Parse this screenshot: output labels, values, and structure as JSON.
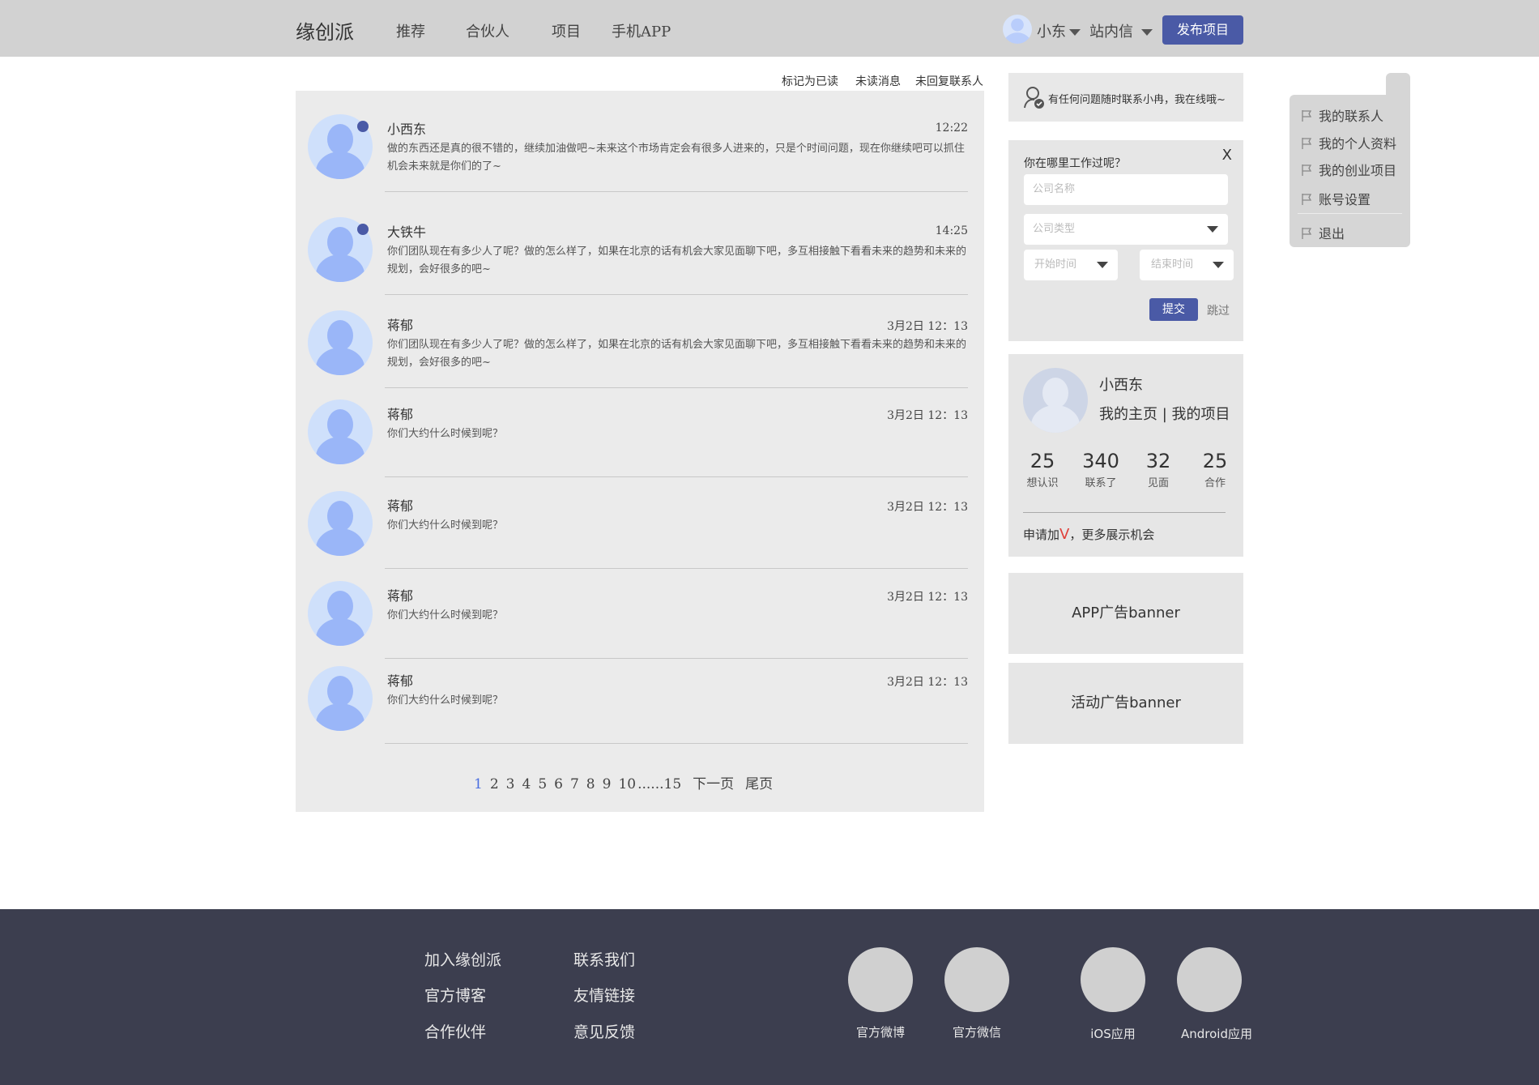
{
  "nav": {
    "logo": "缘创派",
    "items": [
      "推荐",
      "合伙人",
      "项目",
      "手机APP"
    ],
    "user": "小东",
    "messages": "站内信",
    "publish": "发布项目"
  },
  "actions": [
    "标记为已读",
    "未读消息",
    "未回复联系人"
  ],
  "messages": [
    {
      "name": "小西东",
      "time": "12:22",
      "unread": true,
      "text": "做的东西还是真的很不错的，继续加油做吧~未来这个市场肯定会有很多人进来的，只是个时间问题，现在你继续吧可以抓住机会未来就是你们的了~"
    },
    {
      "name": "大铁牛",
      "time": "14:25",
      "unread": true,
      "text": "你们团队现在有多少人了呢？做的怎么样了，如果在北京的话有机会大家见面聊下吧，多互相接触下看看未来的趋势和未来的规划，会好很多的吧~"
    },
    {
      "name": "蒋郁",
      "time": "3月2日 12：13",
      "unread": false,
      "text": "你们团队现在有多少人了呢？做的怎么样了，如果在北京的话有机会大家见面聊下吧，多互相接触下看看未来的趋势和未来的规划，会好很多的吧~"
    },
    {
      "name": "蒋郁",
      "time": "3月2日 12：13",
      "unread": false,
      "text": "你们大约什么时候到呢？"
    },
    {
      "name": "蒋郁",
      "time": "3月2日 12：13",
      "unread": false,
      "text": "你们大约什么时候到呢？"
    },
    {
      "name": "蒋郁",
      "time": "3月2日 12：13",
      "unread": false,
      "text": "你们大约什么时候到呢？"
    },
    {
      "name": "蒋郁",
      "time": "3月2日 12：13",
      "unread": false,
      "text": "你们大约什么时候到呢？"
    }
  ],
  "pagination": [
    "1",
    "2",
    "3",
    "4",
    "5",
    "6",
    "7",
    "8",
    "9",
    "10",
    "......15",
    "下一页",
    "尾页"
  ],
  "help": "有任何问题随时联系小冉，我在线哦~",
  "work_form": {
    "question": "你在哪里工作过呢？",
    "close": "X",
    "company_name_placeholder": "公司名称",
    "company_type_placeholder": "公司类型",
    "start_placeholder": "开始时间",
    "end_placeholder": "结束时间",
    "submit": "提交",
    "skip": "跳过"
  },
  "profile": {
    "name": "小西东",
    "links": "我的主页 | 我的项目",
    "stats": [
      {
        "num": "25",
        "label": "想认识"
      },
      {
        "num": "340",
        "label": "联系了"
      },
      {
        "num": "32",
        "label": "见面"
      },
      {
        "num": "25",
        "label": "合作"
      }
    ],
    "apply_prefix": "申请加",
    "apply_v": "V",
    "apply_suffix": "，更多展示机会"
  },
  "ads": [
    "APP广告banner",
    "活动广告banner"
  ],
  "user_menu": [
    "我的联系人",
    "我的个人资料",
    "我的创业项目",
    "账号设置",
    "退出"
  ],
  "footer": {
    "links_col1": [
      "加入缘创派",
      "官方博客",
      "合作伙伴"
    ],
    "links_col2": [
      "联系我们",
      "友情链接",
      "意见反馈"
    ],
    "social": [
      "官方微博",
      "官方微信",
      "iOS应用",
      "Android应用"
    ]
  },
  "colors": {
    "accent": "#4a5aa6",
    "footer": "#3c3e4f",
    "topbar": "#d2d2d2"
  }
}
